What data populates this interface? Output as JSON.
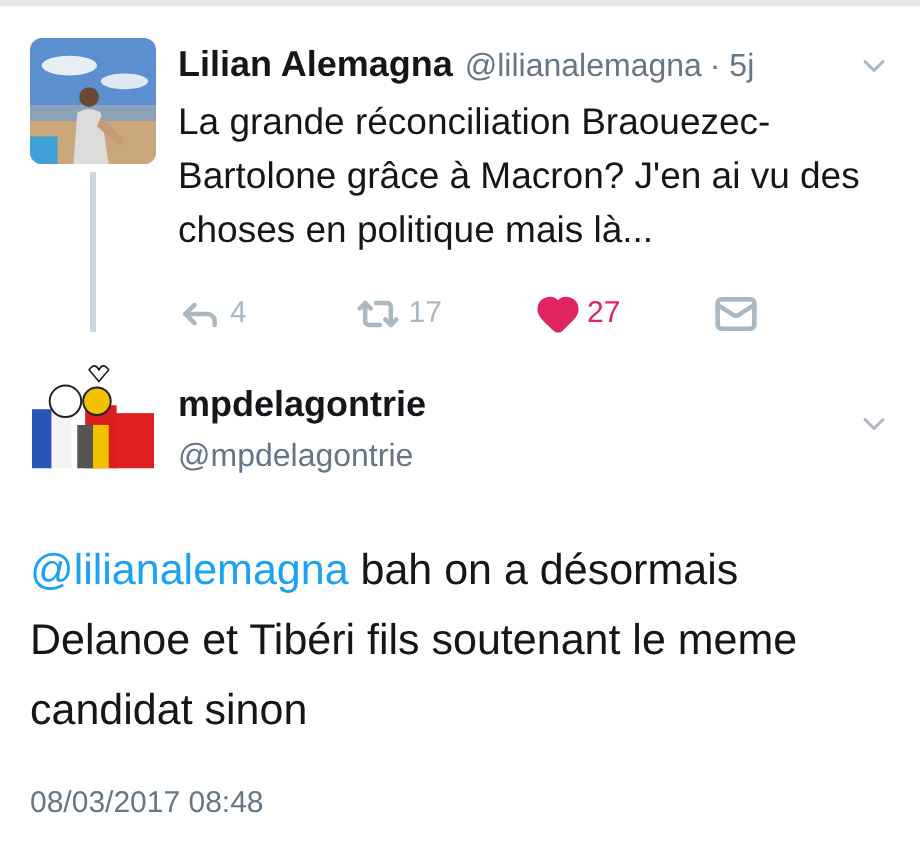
{
  "tweet": {
    "name": "Lilian Alemagna",
    "handle": "@lilianalemagna",
    "time": "· 5j",
    "text": "La grande réconciliation Braouezec-Bartolone grâce à Macron? J'en ai vu des choses en politique mais là...",
    "actions": [
      {
        "kind": "reply",
        "count": "4"
      },
      {
        "kind": "retweet",
        "count": "17"
      },
      {
        "kind": "like",
        "count": "27",
        "liked": true
      },
      {
        "kind": "message"
      }
    ]
  },
  "reply": {
    "name": "mpdelagontrie",
    "handle": "@mpdelagontrie",
    "mention": "@lilianalemagna",
    "text": " bah on a désormais Delanoe et Tibéri fils soutenant le meme candidat sinon",
    "date": "08/03/2017 08:48"
  }
}
